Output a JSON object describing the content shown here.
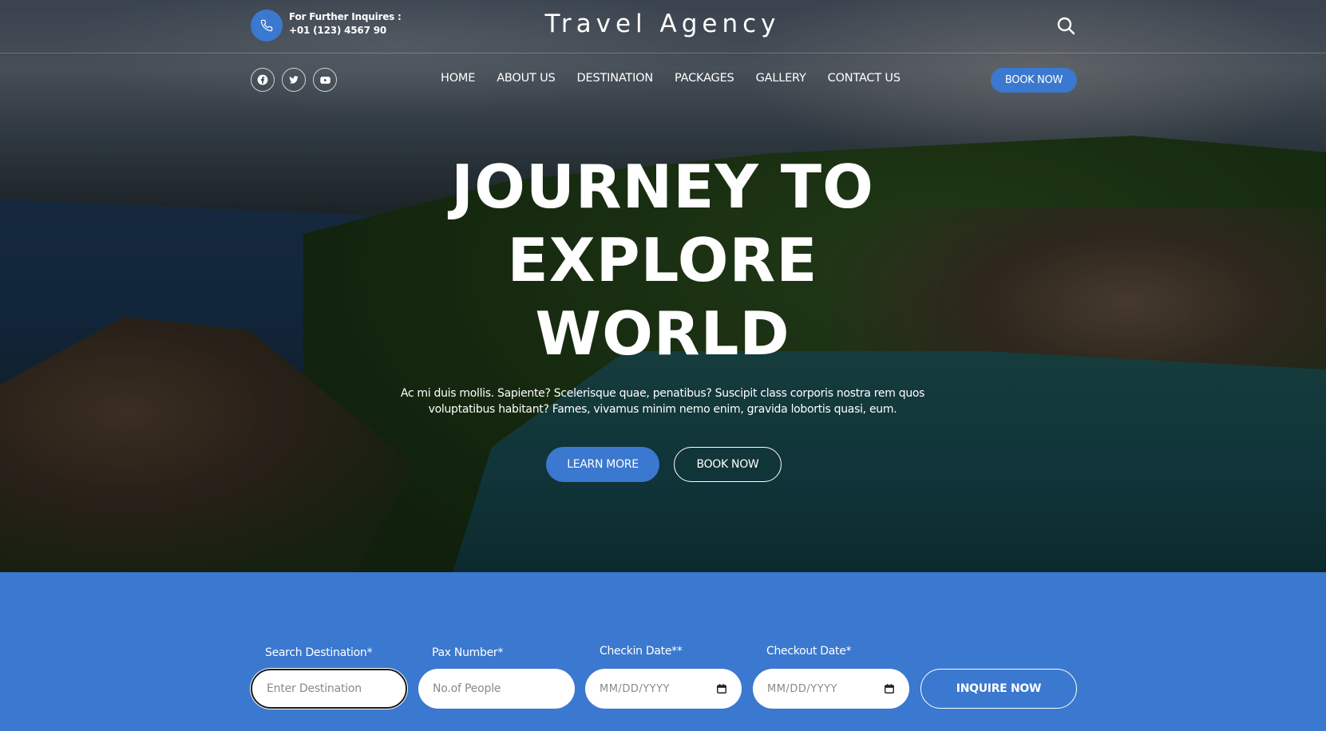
{
  "topbar": {
    "inquire_label": "For Further Inquires :",
    "phone": "+01 (123) 4567 90",
    "brand": "Travel Agency"
  },
  "social": {
    "icons": [
      "facebook-icon",
      "twitter-icon",
      "youtube-icon"
    ]
  },
  "nav": {
    "items": [
      {
        "label": "HOME"
      },
      {
        "label": "ABOUT US"
      },
      {
        "label": "DESTINATION"
      },
      {
        "label": "PACKAGES"
      },
      {
        "label": "GALLERY"
      },
      {
        "label": "CONTACT US"
      }
    ],
    "book_now": "BOOK NOW"
  },
  "hero": {
    "headline_line1": "JOURNEY TO",
    "headline_line2": "EXPLORE",
    "headline_line3": "WORLD",
    "subtext": "Ac mi duis mollis. Sapiente? Scelerisque quae, penatibus? Suscipit class corporis nostra rem quos voluptatibus habitant? Fames, vivamus minim nemo enim, gravida lobortis quasi, eum.",
    "learn_more": "LEARN MORE",
    "book_now": "BOOK NOW"
  },
  "booking": {
    "destination_label": "Search Destination*",
    "destination_placeholder": "Enter Destination",
    "pax_label": "Pax Number*",
    "pax_placeholder": "No.of People",
    "checkin_label": "Checkin Date**",
    "checkin_placeholder": "MM/DD/YYYY",
    "checkout_label": "Checkout Date*",
    "checkout_placeholder": "MM/DD/YYYY",
    "submit": "INQUIRE NOW"
  },
  "colors": {
    "accent": "#3b78cf",
    "text": "#ffffff"
  }
}
